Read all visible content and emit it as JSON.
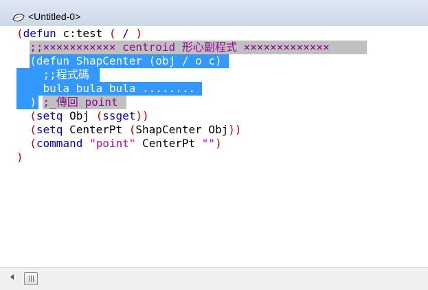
{
  "window": {
    "title": "<Untitled-0>",
    "icon": "file-icon"
  },
  "colors": {
    "paren": "#d10000",
    "keyword": "#0000cc",
    "string": "#cc00cc",
    "comment": "#990099",
    "text": "#000000",
    "selection_bg": "#3399ff",
    "selection_fg": "#ffffff",
    "comment_bg": "#c0c0c0"
  },
  "code": {
    "lines": [
      {
        "tokens": [
          [
            "(",
            "paren"
          ],
          [
            "defun",
            "keyword"
          ],
          [
            " c:test ",
            "text"
          ],
          [
            "(",
            "paren"
          ],
          [
            " / ",
            "keyword"
          ],
          [
            ")",
            "paren"
          ]
        ]
      },
      {
        "tokens": [
          [
            "  ;;××××××××××× centroid 形心副程式 ×××××××××××××",
            "comment"
          ]
        ]
      },
      {
        "tokens": [
          [
            "  (defun ShapCenter (obj / o c)",
            "selection"
          ]
        ]
      },
      {
        "tokens": [
          [
            "    ;;程式碼",
            "selection"
          ]
        ]
      },
      {
        "tokens": [
          [
            "    bula bula bula ........",
            "selection"
          ]
        ]
      },
      {
        "tokens": [
          [
            "  )",
            "selection"
          ],
          [
            " ",
            "text"
          ],
          [
            ";_傳回 point",
            "comment"
          ]
        ]
      },
      {
        "tokens": [
          [
            "  ",
            "text"
          ],
          [
            "(",
            "paren"
          ],
          [
            "setq",
            "keyword"
          ],
          [
            " Obj ",
            "text"
          ],
          [
            "(",
            "paren"
          ],
          [
            "ssget",
            "keyword"
          ],
          [
            "))",
            "paren"
          ]
        ]
      },
      {
        "tokens": [
          [
            "  ",
            "text"
          ],
          [
            "(",
            "paren"
          ],
          [
            "setq",
            "keyword"
          ],
          [
            " CenterPt ",
            "text"
          ],
          [
            "(",
            "paren"
          ],
          [
            "ShapCenter Obj",
            "text"
          ],
          [
            "))",
            "paren"
          ]
        ]
      },
      {
        "tokens": [
          [
            "  ",
            "text"
          ],
          [
            "(",
            "paren"
          ],
          [
            "command",
            "keyword"
          ],
          [
            " ",
            "text"
          ],
          [
            "\"point\"",
            "string"
          ],
          [
            " CenterPt ",
            "text"
          ],
          [
            "\"\"",
            "string"
          ],
          [
            ")",
            "paren"
          ]
        ]
      },
      {
        "tokens": [
          [
            ")",
            "paren"
          ]
        ]
      }
    ]
  },
  "scrollbar": {
    "left_arrow": "scroll-left-arrow-icon",
    "thumb_grip": "grip-icon"
  }
}
